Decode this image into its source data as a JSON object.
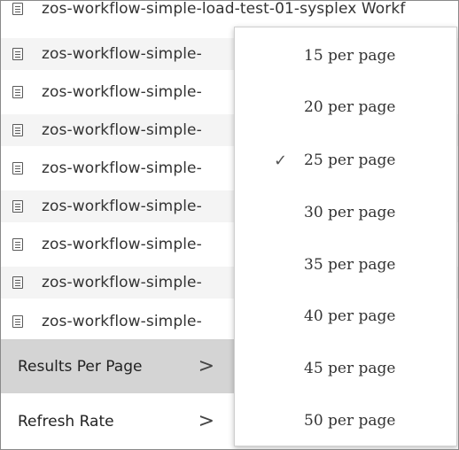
{
  "workflow_list": {
    "rows": [
      {
        "name": "zos-workflow-simple-load-test-01-sysplex  Workf"
      },
      {
        "name": "zos-workflow-simple-"
      },
      {
        "name": "zos-workflow-simple-"
      },
      {
        "name": "zos-workflow-simple-"
      },
      {
        "name": "zos-workflow-simple-"
      },
      {
        "name": "zos-workflow-simple-"
      },
      {
        "name": "zos-workflow-simple-"
      },
      {
        "name": "zos-workflow-simple-"
      },
      {
        "name": "zos-workflow-simple-"
      }
    ],
    "row_icon": "list-document-icon"
  },
  "submenu": {
    "items": [
      {
        "label": "Results Per Page",
        "chevron": ">",
        "active": true
      },
      {
        "label": "Refresh Rate",
        "chevron": ">",
        "active": false
      }
    ]
  },
  "results_per_page_menu": {
    "selected_mark": "✓",
    "selected_value": "25 per page",
    "options": [
      {
        "label": "15 per page",
        "selected": false
      },
      {
        "label": "20 per page",
        "selected": false
      },
      {
        "label": "25 per page",
        "selected": true
      },
      {
        "label": "30 per page",
        "selected": false
      },
      {
        "label": "35 per page",
        "selected": false
      },
      {
        "label": "40 per page",
        "selected": false
      },
      {
        "label": "45 per page",
        "selected": false
      },
      {
        "label": "50 per page",
        "selected": false
      }
    ]
  },
  "colors": {
    "active_item_bg": "#d4d4d4",
    "alt_row_bg": "#f4f4f4",
    "text": "#333333"
  }
}
